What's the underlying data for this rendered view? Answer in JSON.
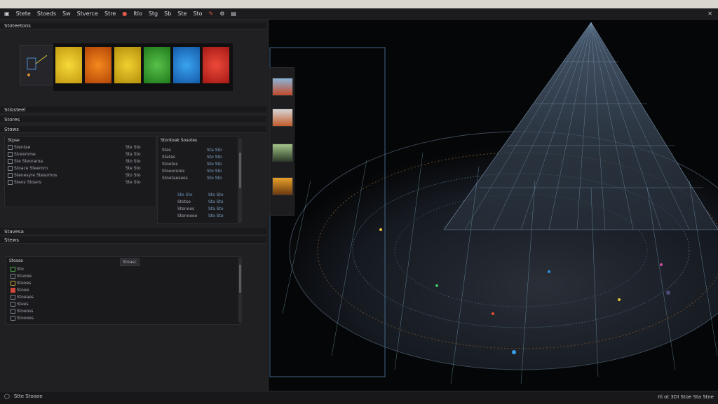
{
  "menu": {
    "items": [
      "Stete",
      "Stoeds",
      "Sw",
      "Stverce",
      "Stre",
      "Itlo",
      "Stg",
      "Sb",
      "Ste",
      "Sto"
    ]
  },
  "panels": {
    "top_header": "Stoteetons",
    "section_a": "Stiosteel",
    "section_b": "Stores",
    "section_c": "Stows",
    "section_d": "Stavesa",
    "section_e": "Stews"
  },
  "left_table": {
    "col1": "Stpse",
    "col2": "Stontoak Sosotes",
    "rows_left": [
      "Stentae",
      "Stresmme",
      "Ste Steoraroa",
      "Stoace Steerorn",
      "Stenesyre Stesomos",
      "Steos Stoans"
    ],
    "vals_left": [
      "Ste Sto",
      "Sta Sto",
      "Sto Sto",
      "Ste Sto",
      "Sto Sto",
      "Ste Sto"
    ],
    "rows_right": [
      "Stes",
      "Stetes",
      "Stoetes",
      "Stoeorores",
      "Stoetaesees"
    ],
    "vals_right": [
      "Sta Sto",
      "Sto Sto",
      "Sto Sto",
      "Sto Sto",
      "Sto Sto"
    ],
    "rows_right2": [
      "Ste Sto",
      "Stotse",
      "Stenoes",
      "Stoeorore",
      "Stenoeee"
    ],
    "vals_right2": [
      "Sto Sto",
      "Sta Sto",
      "Sta Sto",
      "Sto Sto",
      "Sto Sto"
    ]
  },
  "lower_list": {
    "title": "Stossa",
    "tab": "Stoasc",
    "items": [
      "Sto",
      "Stuooe",
      "Steoes",
      "Stooe",
      "Stoeaes",
      "Stees",
      "Stoeoss",
      "Stoooes"
    ]
  },
  "status": {
    "left": "Stte Stoaoe",
    "right": "Iti ot 3DI Stoe Sta Stoe"
  },
  "swatch_colors": [
    "#e8c51c",
    "#e56a14",
    "#e0b820",
    "#3fa63b",
    "#1e86d6",
    "#d72a22"
  ],
  "accent": "#5a8fb4"
}
